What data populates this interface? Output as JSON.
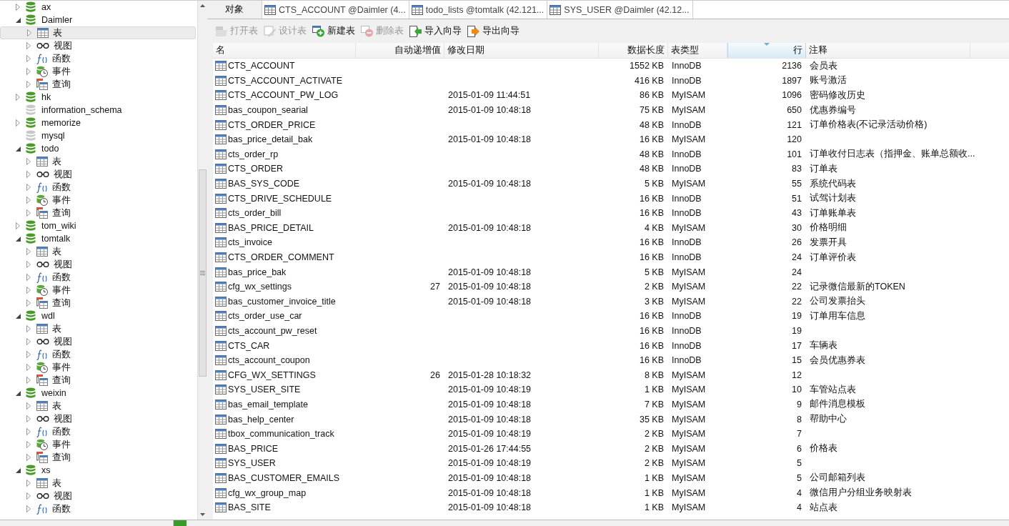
{
  "tree": [
    {
      "name": "ax",
      "open": true,
      "expanded": false
    },
    {
      "name": "Daimler",
      "open": true,
      "expanded": true,
      "children": [
        {
          "kind": "table",
          "label": "表",
          "selected": true
        },
        {
          "kind": "view",
          "label": "视图",
          "selected": false
        },
        {
          "kind": "function",
          "label": "函数",
          "selected": false
        },
        {
          "kind": "event",
          "label": "事件",
          "selected": false
        },
        {
          "kind": "query",
          "label": "查询",
          "selected": false
        }
      ]
    },
    {
      "name": "hk",
      "open": true,
      "expanded": false
    },
    {
      "name": "information_schema",
      "open": false
    },
    {
      "name": "memorize",
      "open": true,
      "expanded": false
    },
    {
      "name": "mysql",
      "open": false
    },
    {
      "name": "todo",
      "open": true,
      "expanded": true,
      "children": [
        {
          "kind": "table",
          "label": "表",
          "selected": false
        },
        {
          "kind": "view",
          "label": "视图",
          "selected": false
        },
        {
          "kind": "function",
          "label": "函数",
          "selected": false
        },
        {
          "kind": "event",
          "label": "事件",
          "selected": false
        },
        {
          "kind": "query",
          "label": "查询",
          "selected": false
        }
      ]
    },
    {
      "name": "tom_wiki",
      "open": true,
      "expanded": false
    },
    {
      "name": "tomtalk",
      "open": true,
      "expanded": true,
      "children": [
        {
          "kind": "table",
          "label": "表",
          "selected": false
        },
        {
          "kind": "view",
          "label": "视图",
          "selected": false
        },
        {
          "kind": "function",
          "label": "函数",
          "selected": false
        },
        {
          "kind": "event",
          "label": "事件",
          "selected": false
        },
        {
          "kind": "query",
          "label": "查询",
          "selected": false
        }
      ]
    },
    {
      "name": "wdl",
      "open": true,
      "expanded": true,
      "children": [
        {
          "kind": "table",
          "label": "表",
          "selected": false
        },
        {
          "kind": "view",
          "label": "视图",
          "selected": false
        },
        {
          "kind": "function",
          "label": "函数",
          "selected": false
        },
        {
          "kind": "event",
          "label": "事件",
          "selected": false
        },
        {
          "kind": "query",
          "label": "查询",
          "selected": false
        }
      ]
    },
    {
      "name": "weixin",
      "open": true,
      "expanded": true,
      "children": [
        {
          "kind": "table",
          "label": "表",
          "selected": false
        },
        {
          "kind": "view",
          "label": "视图",
          "selected": false
        },
        {
          "kind": "function",
          "label": "函数",
          "selected": false
        },
        {
          "kind": "event",
          "label": "事件",
          "selected": false
        },
        {
          "kind": "query",
          "label": "查询",
          "selected": false
        }
      ]
    },
    {
      "name": "xs",
      "open": true,
      "expanded": true,
      "children": [
        {
          "kind": "table",
          "label": "表",
          "selected": false
        },
        {
          "kind": "view",
          "label": "视图",
          "selected": false
        },
        {
          "kind": "function",
          "label": "函数",
          "selected": false
        }
      ]
    }
  ],
  "tabs": [
    {
      "kind": "objects",
      "label": "对象",
      "selected": true
    },
    {
      "kind": "table",
      "label": "CTS_ACCOUNT @Daimler (4...",
      "selected": false
    },
    {
      "kind": "table",
      "label": "todo_lists @tomtalk (42.121...",
      "selected": false
    },
    {
      "kind": "table",
      "label": "SYS_USER @Daimler (42.12...",
      "selected": false
    }
  ],
  "toolbar": [
    {
      "kind": "open",
      "label": "打开表",
      "disabled": true
    },
    {
      "kind": "design",
      "label": "设计表",
      "disabled": true
    },
    {
      "kind": "new",
      "label": "新建表",
      "disabled": false
    },
    {
      "kind": "delete",
      "label": "删除表",
      "disabled": true
    },
    {
      "kind": "import",
      "label": "导入向导",
      "disabled": false
    },
    {
      "kind": "export",
      "label": "导出向导",
      "disabled": false
    }
  ],
  "table": {
    "columns": [
      {
        "label": "名",
        "sorted": false
      },
      {
        "label": "自动递增值",
        "sorted": false
      },
      {
        "label": "修改日期",
        "sorted": false
      },
      {
        "label": "数据长度",
        "sorted": false
      },
      {
        "label": "表类型",
        "sorted": false
      },
      {
        "label": "行",
        "sorted": true
      },
      {
        "label": "注释",
        "sorted": false
      }
    ],
    "rows": [
      {
        "name": "CTS_ACCOUNT",
        "size": "1552 KB",
        "type": "InnoDB",
        "rows": "2136",
        "comment": "会员表"
      },
      {
        "name": "CTS_ACCOUNT_ACTIVATE",
        "size": "416 KB",
        "type": "InnoDB",
        "rows": "1897",
        "comment": "账号激活"
      },
      {
        "name": "CTS_ACCOUNT_PW_LOG",
        "modified": "2015-01-09 11:44:51",
        "size": "86 KB",
        "type": "MyISAM",
        "rows": "1096",
        "comment": "密码修改历史"
      },
      {
        "name": "bas_coupon_searial",
        "modified": "2015-01-09 10:48:18",
        "size": "75 KB",
        "type": "MyISAM",
        "rows": "650",
        "comment": "优惠券编号"
      },
      {
        "name": "CTS_ORDER_PRICE",
        "size": "48 KB",
        "type": "InnoDB",
        "rows": "121",
        "comment": "订单价格表(不记录活动价格)"
      },
      {
        "name": "bas_price_detail_bak",
        "modified": "2015-01-09 10:48:18",
        "size": "16 KB",
        "type": "MyISAM",
        "rows": "120"
      },
      {
        "name": "cts_order_rp",
        "size": "48 KB",
        "type": "InnoDB",
        "rows": "101",
        "comment": "订单收付日志表（指押金、账单总额收..."
      },
      {
        "name": "CTS_ORDER",
        "size": "48 KB",
        "type": "InnoDB",
        "rows": "83",
        "comment": "订单表"
      },
      {
        "name": "BAS_SYS_CODE",
        "modified": "2015-01-09 10:48:18",
        "size": "5 KB",
        "type": "MyISAM",
        "rows": "55",
        "comment": "系统代码表"
      },
      {
        "name": "CTS_DRIVE_SCHEDULE",
        "size": "16 KB",
        "type": "InnoDB",
        "rows": "51",
        "comment": "试驾计划表"
      },
      {
        "name": "cts_order_bill",
        "size": "16 KB",
        "type": "InnoDB",
        "rows": "43",
        "comment": "订单账单表"
      },
      {
        "name": "BAS_PRICE_DETAIL",
        "modified": "2015-01-09 10:48:18",
        "size": "4 KB",
        "type": "MyISAM",
        "rows": "30",
        "comment": "价格明细"
      },
      {
        "name": "cts_invoice",
        "size": "16 KB",
        "type": "InnoDB",
        "rows": "26",
        "comment": "发票开具"
      },
      {
        "name": "CTS_ORDER_COMMENT",
        "size": "16 KB",
        "type": "InnoDB",
        "rows": "24",
        "comment": "订单评价表"
      },
      {
        "name": "bas_price_bak",
        "modified": "2015-01-09 10:48:18",
        "size": "5 KB",
        "type": "MyISAM",
        "rows": "24"
      },
      {
        "name": "cfg_wx_settings",
        "auto_increment": "27",
        "modified": "2015-01-09 10:48:18",
        "size": "2 KB",
        "type": "MyISAM",
        "rows": "22",
        "comment": "记录微信最新的TOKEN"
      },
      {
        "name": "bas_customer_invoice_title",
        "modified": "2015-01-09 10:48:18",
        "size": "3 KB",
        "type": "MyISAM",
        "rows": "22",
        "comment": "公司发票抬头"
      },
      {
        "name": "cts_order_use_car",
        "size": "16 KB",
        "type": "InnoDB",
        "rows": "19",
        "comment": "订单用车信息"
      },
      {
        "name": "cts_account_pw_reset",
        "size": "16 KB",
        "type": "InnoDB",
        "rows": "19"
      },
      {
        "name": "CTS_CAR",
        "size": "16 KB",
        "type": "InnoDB",
        "rows": "17",
        "comment": "车辆表"
      },
      {
        "name": "cts_account_coupon",
        "size": "16 KB",
        "type": "InnoDB",
        "rows": "15",
        "comment": "会员优惠券表"
      },
      {
        "name": "CFG_WX_SETTINGS",
        "auto_increment": "26",
        "modified": "2015-01-28 10:18:32",
        "size": "8 KB",
        "type": "MyISAM",
        "rows": "12"
      },
      {
        "name": "SYS_USER_SITE",
        "modified": "2015-01-09 10:48:19",
        "size": "1 KB",
        "type": "MyISAM",
        "rows": "10",
        "comment": "车管站点表"
      },
      {
        "name": "bas_email_template",
        "modified": "2015-01-09 10:48:18",
        "size": "7 KB",
        "type": "MyISAM",
        "rows": "9",
        "comment": "邮件消息模板"
      },
      {
        "name": "bas_help_center",
        "modified": "2015-01-09 10:48:18",
        "size": "35 KB",
        "type": "MyISAM",
        "rows": "8",
        "comment": "帮助中心"
      },
      {
        "name": "tbox_communication_track",
        "modified": "2015-01-09 10:48:19",
        "size": "2 KB",
        "type": "MyISAM",
        "rows": "7"
      },
      {
        "name": "BAS_PRICE",
        "modified": "2015-01-26 17:44:55",
        "size": "2 KB",
        "type": "MyISAM",
        "rows": "6",
        "comment": "价格表"
      },
      {
        "name": "SYS_USER",
        "modified": "2015-01-09 10:48:19",
        "size": "2 KB",
        "type": "MyISAM",
        "rows": "5"
      },
      {
        "name": "BAS_CUSTOMER_EMAILS",
        "modified": "2015-01-09 10:48:18",
        "size": "1 KB",
        "type": "MyISAM",
        "rows": "5",
        "comment": "公司邮箱列表"
      },
      {
        "name": "cfg_wx_group_map",
        "modified": "2015-01-09 10:48:18",
        "size": "1 KB",
        "type": "MyISAM",
        "rows": "4",
        "comment": "微信用户分组业务映射表"
      },
      {
        "name": "BAS_SITE",
        "modified": "2015-01-09 10:48:18",
        "size": "1 KB",
        "type": "MyISAM",
        "rows": "4",
        "comment": "站点表"
      }
    ]
  }
}
